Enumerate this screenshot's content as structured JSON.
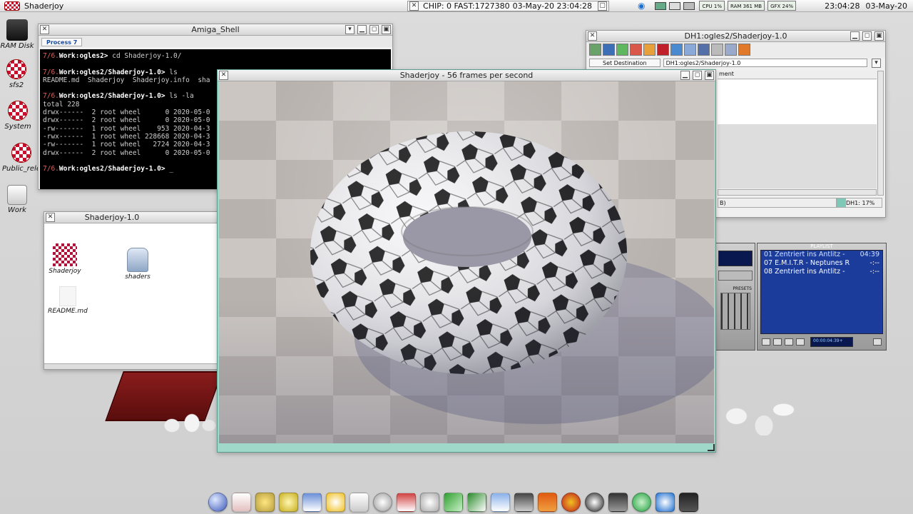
{
  "topbar": {
    "app_name": "Shaderjoy",
    "memory": "CHIP:   0 FAST:1727380",
    "datetime": "03-May-20 23:04:28",
    "cpu": "CPU 1%",
    "ram": "RAM 361 MB",
    "gfx": "GFX 24%",
    "clock": "23:04:28",
    "date": "03-May-20"
  },
  "desktop_icons": [
    {
      "label": "RAM Disk"
    },
    {
      "label": "sfs2"
    },
    {
      "label": "System"
    },
    {
      "label": "Public_rele"
    },
    {
      "label": "Work"
    }
  ],
  "amiga_shell": {
    "title": "Amiga_Shell",
    "tab": "Process 7",
    "lines": [
      {
        "prompt": "7/6.",
        "path": "Work:ogles2>",
        "cmd": "cd Shaderjoy-1.0/"
      },
      {
        "prompt": "",
        "path": "",
        "cmd": ""
      },
      {
        "prompt": "7/6.",
        "path": "Work:ogles2/Shaderjoy-1.0>",
        "cmd": "ls"
      },
      {
        "prompt": "",
        "path": "",
        "cmd": "README.md  Shaderjoy  Shaderjoy.info  sha"
      },
      {
        "prompt": "",
        "path": "",
        "cmd": ""
      },
      {
        "prompt": "7/6.",
        "path": "Work:ogles2/Shaderjoy-1.0>",
        "cmd": "ls -la"
      },
      {
        "prompt": "",
        "path": "",
        "cmd": "total 228"
      },
      {
        "prompt": "",
        "path": "",
        "cmd": "drwx------  2 root wheel      0 2020-05-0"
      },
      {
        "prompt": "",
        "path": "",
        "cmd": "drwx------  2 root wheel      0 2020-05-0"
      },
      {
        "prompt": "",
        "path": "",
        "cmd": "-rw-------  1 root wheel    953 2020-04-3"
      },
      {
        "prompt": "",
        "path": "",
        "cmd": "-rwx------  1 root wheel 228668 2020-04-3"
      },
      {
        "prompt": "",
        "path": "",
        "cmd": "-rw-------  1 root wheel   2724 2020-04-3"
      },
      {
        "prompt": "",
        "path": "",
        "cmd": "drwx------  2 root wheel      0 2020-05-0"
      },
      {
        "prompt": "",
        "path": "",
        "cmd": ""
      },
      {
        "prompt": "7/6.",
        "path": "Work:ogles2/Shaderjoy-1.0>",
        "cmd": "_"
      }
    ]
  },
  "drawer": {
    "title": "Shaderjoy-1.0",
    "items": [
      {
        "label": "Shaderjoy"
      },
      {
        "label": "shaders"
      },
      {
        "label": "README.md"
      }
    ]
  },
  "shaderjoy": {
    "title": "Shaderjoy - 56 frames per second"
  },
  "filer": {
    "title": "DH1:ogles2/Shaderjoy-1.0",
    "dest_button": "Set Destination",
    "path": "DH1:ogles2/Shaderjoy-1.0",
    "col": "ment",
    "status_left": "B)",
    "status_right": "DH1: 17%"
  },
  "player": {
    "header": "PLAYLIST",
    "playlist": [
      {
        "title": "01 Zentriert ins Antlitz -",
        "time": "04:39"
      },
      {
        "title": "07 E.M.I.T.R - Neptunes R",
        "time": "-:--"
      },
      {
        "title": "08 Zentriert ins Antlitz -",
        "time": "-:--"
      }
    ],
    "presets": "PRESETS",
    "counter": "00:00:04:39+"
  },
  "colors": {
    "term_prompt": "#e06060",
    "playlist_bg": "#1c3c9c",
    "shader_frame": "#8fd0c0"
  }
}
